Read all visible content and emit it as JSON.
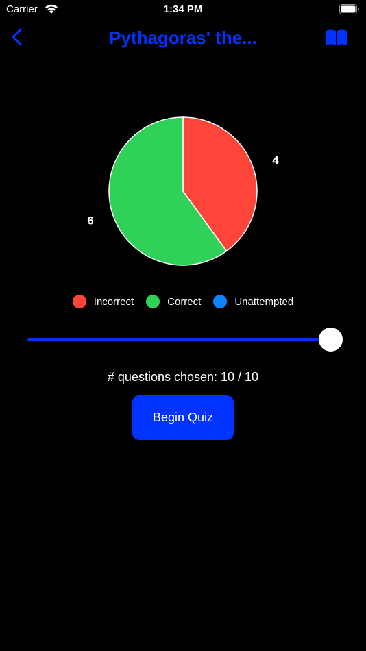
{
  "status_bar": {
    "carrier": "Carrier",
    "time": "1:34 PM"
  },
  "nav": {
    "title": "Pythagoras' the...",
    "back_icon": "chevron-left-icon",
    "book_icon": "book-icon"
  },
  "colors": {
    "accent": "#0033ff",
    "incorrect": "#ff453a",
    "correct": "#30d158",
    "unattempted": "#0a84ff",
    "background": "#000000"
  },
  "chart_data": {
    "type": "pie",
    "slices": [
      {
        "name": "Incorrect",
        "value": 4,
        "color": "#ff453a"
      },
      {
        "name": "Correct",
        "value": 6,
        "color": "#30d158"
      },
      {
        "name": "Unattempted",
        "value": 0,
        "color": "#0a84ff"
      }
    ],
    "data_labels": [
      "4",
      "6"
    ],
    "legend": [
      "Incorrect",
      "Correct",
      "Unattempted"
    ],
    "legend_position": "bottom"
  },
  "slider": {
    "value": 10,
    "max": 10,
    "fraction": 1.0
  },
  "question_count": {
    "text": "# questions chosen:  10 / 10"
  },
  "begin_button": {
    "label": "Begin Quiz"
  }
}
